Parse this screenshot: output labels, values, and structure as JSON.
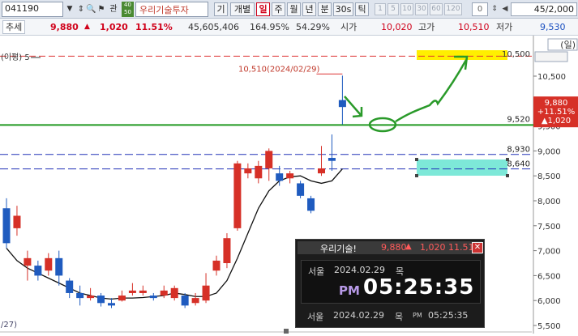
{
  "toolbar": {
    "stock_code": "041190",
    "badge_top": "40",
    "badge_bottom": "50",
    "company": "우리기술투자",
    "icons": [
      "arrows-icon",
      "search-icon",
      "flag-icon",
      "compare-icon"
    ],
    "icon_glyphs": [
      "⇕",
      "🔍",
      "⚑",
      "관"
    ],
    "buttons": [
      "기",
      "개별",
      "일",
      "주",
      "월",
      "년",
      "분",
      "30s",
      "틱"
    ],
    "selected_period": "일",
    "number_buttons": [
      "1",
      "5",
      "10",
      "30",
      "60",
      "120"
    ],
    "zero_value": "0",
    "page_current": "45",
    "page_total": "2,000"
  },
  "quote": {
    "label": "추세",
    "price": "9,880",
    "arrow": "▲",
    "change": "1,020",
    "change_pct": "11.51%",
    "volume": "45,605,406",
    "ratio1": "164.95%",
    "ratio2": "54.29%",
    "open_label": "시가",
    "open": "10,020",
    "high_label": "고가",
    "high": "10,510",
    "low_label": "저가",
    "low": "9,530"
  },
  "chart_data": {
    "type": "candlestick",
    "unit_label": "(일)",
    "indicator_label": "(이평) 5",
    "y_axis_ticks": [
      10500,
      10000,
      9500,
      9000,
      8500,
      8000,
      7500,
      7000,
      6500,
      6000,
      5500
    ],
    "y_axis_tick_labels": [
      "10,500",
      "10,000",
      "9,500",
      "9,000",
      "8,500",
      "8,000",
      "7,500",
      "7,000",
      "6,500",
      "6,000",
      "5,500"
    ],
    "ylim": [
      5450,
      10600
    ],
    "max_annotation": "10,510(2024/02/29)",
    "date_fragment": "/27)",
    "support_line": {
      "value": 9520,
      "label": "9,520"
    },
    "line_8930": {
      "value": 8930,
      "label": "8,930"
    },
    "line_8640": {
      "value": 8640,
      "label": "8,640"
    },
    "top_label": "10,500",
    "red_dashed_value": 10510,
    "current_box": {
      "price": "9,880",
      "pct": "+11.51%",
      "change": "▲1,020"
    },
    "candles": [
      {
        "o": 7850,
        "c": 7150,
        "h": 8050,
        "l": 7050
      },
      {
        "o": 7450,
        "c": 7700,
        "h": 7900,
        "l": 7300
      },
      {
        "o": 6700,
        "c": 6850,
        "h": 7000,
        "l": 6400
      },
      {
        "o": 6700,
        "c": 6500,
        "h": 6800,
        "l": 6400
      },
      {
        "o": 6600,
        "c": 6850,
        "h": 6950,
        "l": 6500
      },
      {
        "o": 6850,
        "c": 6500,
        "h": 7000,
        "l": 6300
      },
      {
        "o": 6400,
        "c": 6150,
        "h": 6450,
        "l": 6050
      },
      {
        "o": 6150,
        "c": 6050,
        "h": 6300,
        "l": 5900
      },
      {
        "o": 6050,
        "c": 6100,
        "h": 6250,
        "l": 6000
      },
      {
        "o": 6100,
        "c": 5950,
        "h": 6150,
        "l": 5880
      },
      {
        "o": 5950,
        "c": 5900,
        "h": 6050,
        "l": 5850
      },
      {
        "o": 6000,
        "c": 6100,
        "h": 6200,
        "l": 5980
      },
      {
        "o": 6150,
        "c": 6200,
        "h": 6350,
        "l": 6100
      },
      {
        "o": 6150,
        "c": 6200,
        "h": 6300,
        "l": 6100
      },
      {
        "o": 6100,
        "c": 6050,
        "h": 6150,
        "l": 6000
      },
      {
        "o": 6100,
        "c": 6200,
        "h": 6300,
        "l": 6050
      },
      {
        "o": 6050,
        "c": 6250,
        "h": 6300,
        "l": 6000
      },
      {
        "o": 6100,
        "c": 5900,
        "h": 6150,
        "l": 5850
      },
      {
        "o": 5950,
        "c": 6050,
        "h": 6150,
        "l": 5900
      },
      {
        "o": 6000,
        "c": 6300,
        "h": 6550,
        "l": 5950
      },
      {
        "o": 6600,
        "c": 6800,
        "h": 6900,
        "l": 6500
      },
      {
        "o": 6750,
        "c": 7250,
        "h": 7350,
        "l": 6650
      },
      {
        "o": 7450,
        "c": 8750,
        "h": 8800,
        "l": 7400
      },
      {
        "o": 8550,
        "c": 8650,
        "h": 8750,
        "l": 8450
      },
      {
        "o": 8450,
        "c": 8700,
        "h": 8800,
        "l": 8350
      },
      {
        "o": 8650,
        "c": 9000,
        "h": 9050,
        "l": 8400
      },
      {
        "o": 8550,
        "c": 8400,
        "h": 8700,
        "l": 8300
      },
      {
        "o": 8450,
        "c": 8550,
        "h": 8600,
        "l": 8350
      },
      {
        "o": 8350,
        "c": 8100,
        "h": 8400,
        "l": 8050
      },
      {
        "o": 8050,
        "c": 7800,
        "h": 8100,
        "l": 7750
      },
      {
        "o": 8550,
        "c": 8650,
        "h": 9100,
        "l": 8500
      },
      {
        "o": 8860,
        "c": 8800,
        "h": 9330,
        "l": 8600
      },
      {
        "o": 10020,
        "c": 9880,
        "h": 10510,
        "l": 9530
      }
    ],
    "ma5": [
      7050,
      6800,
      6650,
      6550,
      6450,
      6350,
      6250,
      6150,
      6100,
      6050,
      6030,
      6050,
      6050,
      6060,
      6080,
      6100,
      6150,
      6120,
      6080,
      6080,
      6150,
      6400,
      6850,
      7350,
      7850,
      8200,
      8400,
      8480,
      8500,
      8400,
      8350,
      8400,
      8640
    ]
  },
  "popup": {
    "title": "우리기술!",
    "price": "9,880",
    "arrow": "▲",
    "change": "1,020",
    "pct": "11.51",
    "close": "✕",
    "city": "서울",
    "date": "2024.02.29",
    "day": "목",
    "ampm": "PM",
    "time": "05:25:35",
    "bottom_ampm": "PM"
  }
}
